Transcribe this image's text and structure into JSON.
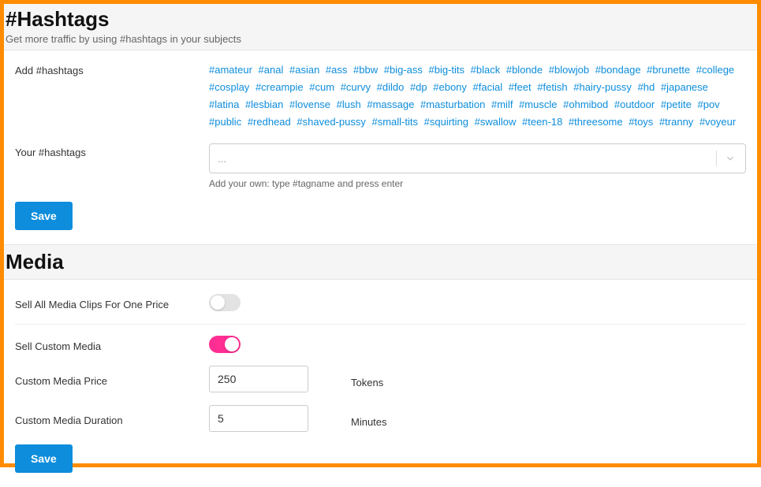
{
  "hashtags": {
    "title": "#Hashtags",
    "subtitle": "Get more traffic by using #hashtags in your subjects",
    "add_label": "Add #hashtags",
    "your_label": "Your #hashtags",
    "select_placeholder": "...",
    "hint": "Add your own: type #tagname and press enter",
    "save_label": "Save",
    "tags": [
      "#amateur",
      "#anal",
      "#asian",
      "#ass",
      "#bbw",
      "#big-ass",
      "#big-tits",
      "#black",
      "#blonde",
      "#blowjob",
      "#bondage",
      "#brunette",
      "#college",
      "#cosplay",
      "#creampie",
      "#cum",
      "#curvy",
      "#dildo",
      "#dp",
      "#ebony",
      "#facial",
      "#feet",
      "#fetish",
      "#hairy-pussy",
      "#hd",
      "#japanese",
      "#latina",
      "#lesbian",
      "#lovense",
      "#lush",
      "#massage",
      "#masturbation",
      "#milf",
      "#muscle",
      "#ohmibod",
      "#outdoor",
      "#petite",
      "#pov",
      "#public",
      "#redhead",
      "#shaved-pussy",
      "#small-tits",
      "#squirting",
      "#swallow",
      "#teen-18",
      "#threesome",
      "#toys",
      "#tranny",
      "#voyeur"
    ]
  },
  "media": {
    "title": "Media",
    "sell_all_label": "Sell All Media Clips For One Price",
    "sell_all_on": false,
    "sell_custom_label": "Sell Custom Media",
    "sell_custom_on": true,
    "price_label": "Custom Media Price",
    "price_value": "250",
    "price_suffix": "Tokens",
    "duration_label": "Custom Media Duration",
    "duration_value": "5",
    "duration_suffix": "Minutes",
    "save_label": "Save"
  }
}
